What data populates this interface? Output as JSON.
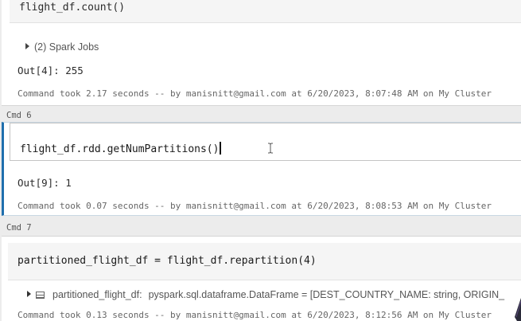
{
  "cells": [
    {
      "code": "flight_df.count()",
      "jobs_label": "(2) Spark Jobs",
      "output": "Out[4]: 255",
      "took": "Command took 2.17 seconds -- by manisnitt@gmail.com at 6/20/2023, 8:07:48 AM on My Cluster"
    },
    {
      "cmd_label": "Cmd 6",
      "code": "flight_df.rdd.getNumPartitions()",
      "output": "Out[9]: 1",
      "took": "Command took 0.07 seconds -- by manisnitt@gmail.com at 6/20/2023, 8:08:53 AM on My Cluster"
    },
    {
      "cmd_label": "Cmd 7",
      "code": "partitioned_flight_df = flight_df.repartition(4)",
      "df_name": "partitioned_flight_df:",
      "df_schema": "pyspark.sql.dataframe.DataFrame = [DEST_COUNTRY_NAME: string, ORIGIN_",
      "took": "Command took 0.13 seconds -- by manisnitt@gmail.com at 6/20/2023, 8:12:56 AM on My Cluster"
    }
  ],
  "colors": {
    "active_border": "#1f6fad",
    "code_bg": "#f5f5f5",
    "page_bg": "#ececec"
  }
}
